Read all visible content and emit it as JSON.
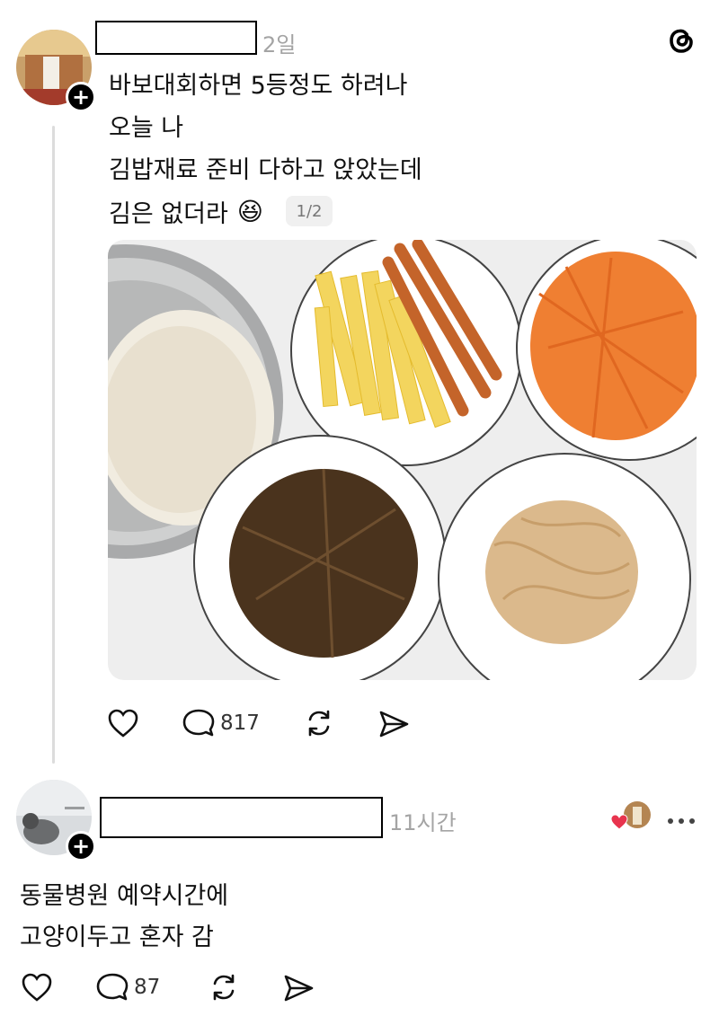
{
  "post1": {
    "time": "2일",
    "lines": [
      "바보대회하면 5등정도 하려나",
      "오늘 나",
      "김밥재료 준비 다하고 앉았는데",
      "김은 없더라"
    ],
    "emoji": "😆",
    "page_indicator": "1/2",
    "counts": {
      "comments": "817"
    }
  },
  "post2": {
    "time": "11시간",
    "lines": [
      "동물병원 예약시간에",
      "고양이두고 혼자 감"
    ],
    "counts": {
      "comments": "87"
    }
  },
  "icons": [
    "threads-logo-icon",
    "heart-icon",
    "comment-icon",
    "repost-icon",
    "share-icon",
    "more-icon",
    "plus-icon"
  ],
  "colors": {
    "like_red": "#e8344e",
    "timestamp_gray": "#a4a4a4",
    "text": "#111111",
    "background": "#ffffff"
  }
}
